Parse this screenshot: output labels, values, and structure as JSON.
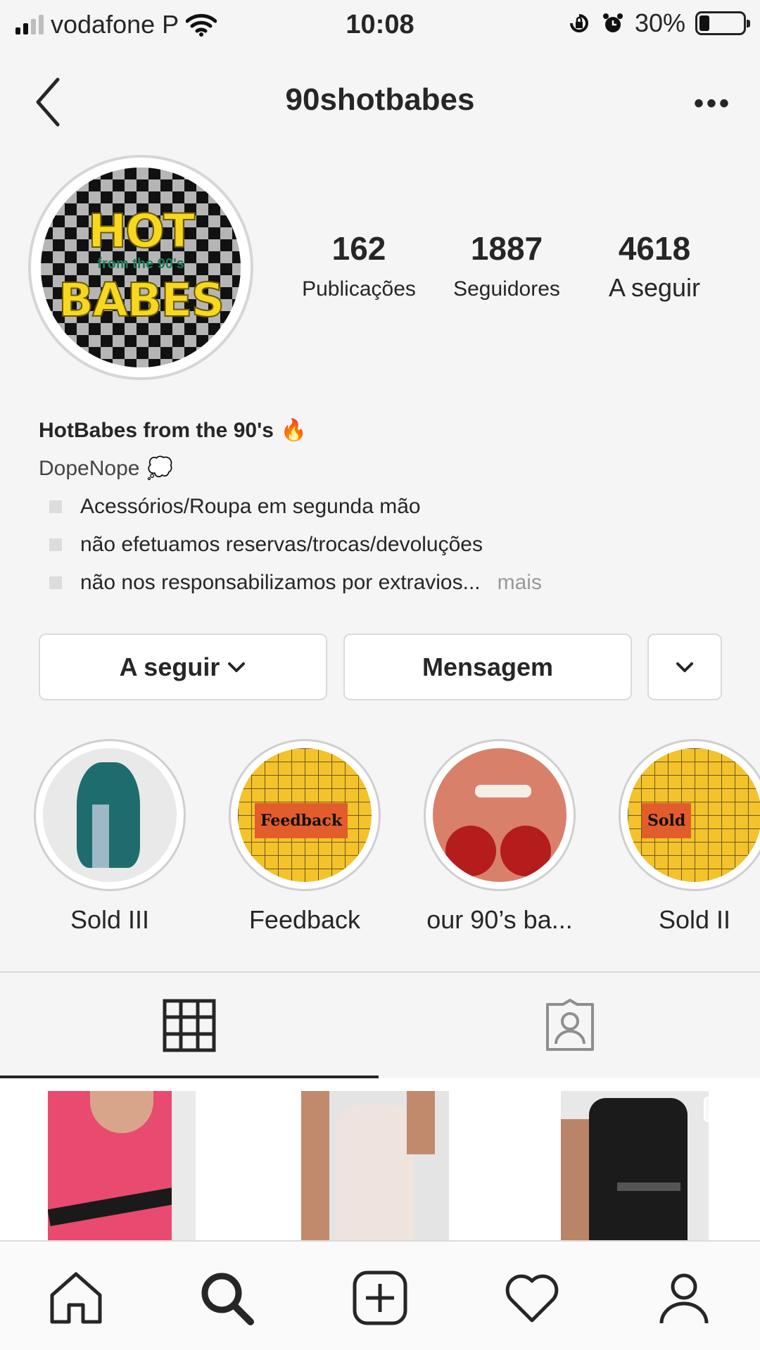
{
  "status_bar": {
    "carrier": "vodafone P",
    "time": "10:08",
    "battery_percent": "30%",
    "battery_level": 0.3
  },
  "header": {
    "username": "90shotbabes"
  },
  "avatar": {
    "logo_lines": [
      "HOT",
      "from the 90's",
      "BABES"
    ]
  },
  "stats": [
    {
      "count": "162",
      "label": "Publicações"
    },
    {
      "count": "1887",
      "label": "Seguidores"
    },
    {
      "count": "4618",
      "label": "A seguir"
    }
  ],
  "bio": {
    "name": "HotBabes from the 90's",
    "name_emoji": "🔥",
    "category": "DopeNope",
    "category_emoji": "💭",
    "lines": [
      "Acessórios/Roupa em segunda mão",
      "não efetuamos reservas/trocas/devoluções",
      "não nos responsabilizamos por extravios..."
    ],
    "more_label": "mais"
  },
  "buttons": {
    "following": "A seguir",
    "message": "Mensagem"
  },
  "highlights": [
    {
      "label": "Sold III"
    },
    {
      "label": "Feedback",
      "cover_text": "Feedback"
    },
    {
      "label": "our 90’s ba..."
    },
    {
      "label": "Sold II",
      "cover_text": "Sold"
    }
  ],
  "icons": {
    "status": [
      "signal-icon",
      "wifi-icon",
      "orientation-lock-icon",
      "alarm-icon",
      "battery-icon"
    ],
    "header": [
      "back-icon",
      "more-icon"
    ],
    "profile_tabs": [
      "grid-icon",
      "tagged-icon"
    ],
    "tab_bar": [
      "home-icon",
      "search-icon",
      "new-post-icon",
      "activity-icon",
      "profile-icon"
    ]
  },
  "colors": {
    "text": "#262626",
    "muted": "#999999",
    "border": "#dbdbdb",
    "background": "#f5f5f5"
  }
}
